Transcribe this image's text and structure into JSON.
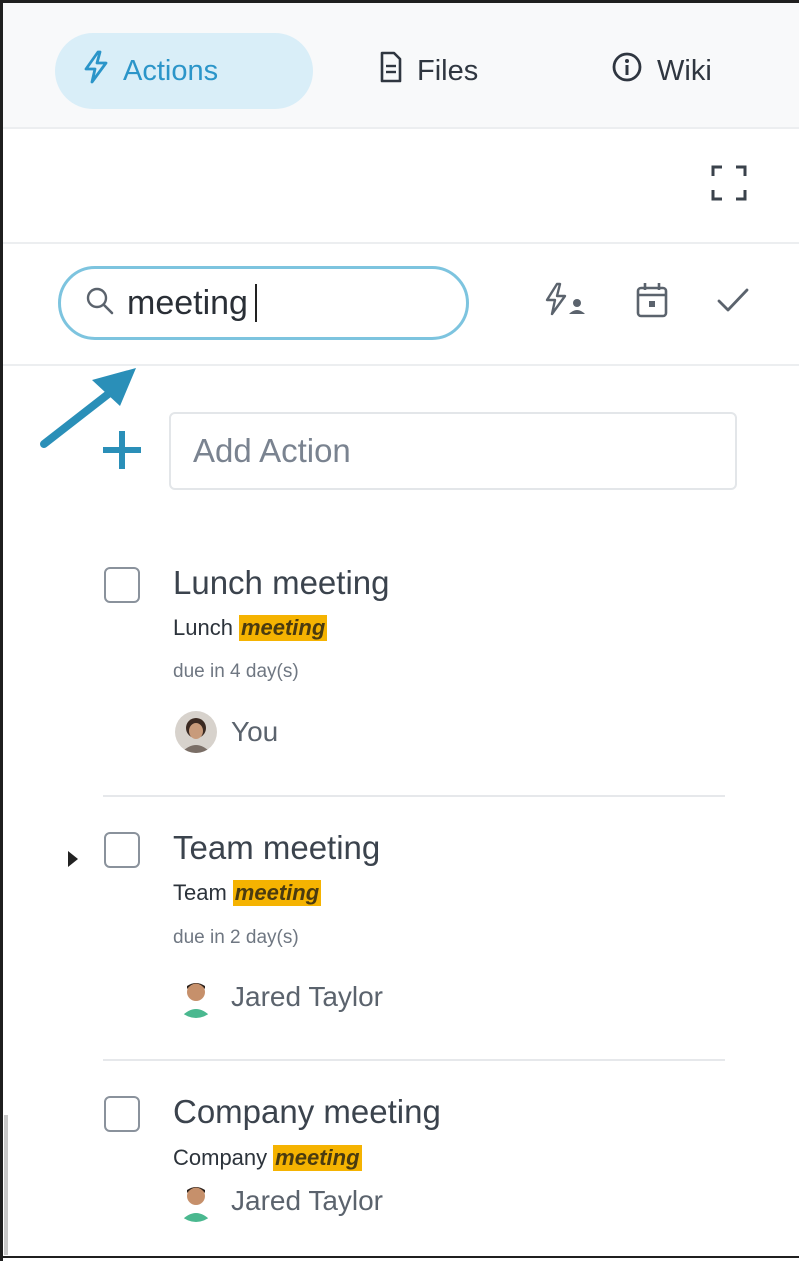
{
  "tabs": [
    {
      "label": "Actions",
      "icon": "bolt-icon",
      "active": true
    },
    {
      "label": "Files",
      "icon": "document-icon",
      "active": false
    },
    {
      "label": "Wiki",
      "icon": "info-icon",
      "active": false
    }
  ],
  "search": {
    "value": "meeting",
    "placeholder": ""
  },
  "filters": [
    "assigned-to-me-icon",
    "calendar-icon",
    "checkmark-icon"
  ],
  "add_action": {
    "placeholder": "Add Action"
  },
  "actions": [
    {
      "title": "Lunch meeting",
      "sub_prefix": "Lunch",
      "sub_highlight": "meeting",
      "due": "due in 4 day(s)",
      "assignee": "You"
    },
    {
      "title": "Team meeting",
      "sub_prefix": "Team",
      "sub_highlight": "meeting",
      "due": "due in 2 day(s)",
      "assignee": "Jared Taylor"
    },
    {
      "title": "Company meeting",
      "sub_prefix": "Company",
      "sub_highlight": "meeting",
      "due": "",
      "assignee": "Jared Taylor"
    }
  ],
  "colors": {
    "accent": "#2b95c9",
    "highlight": "#f5b301",
    "search_border": "#7dc4df"
  }
}
